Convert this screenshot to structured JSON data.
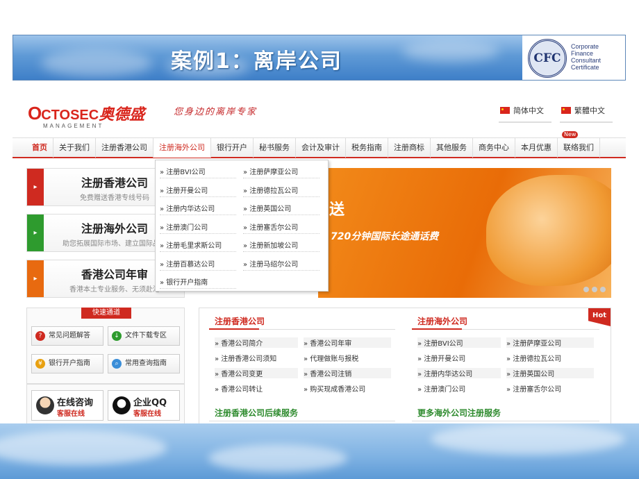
{
  "slide": {
    "title": "案例1：离岸公司",
    "logo_seal": "CFC",
    "logo_text": [
      "Corporate",
      "Finance",
      "Consultant",
      "Certificate"
    ]
  },
  "site": {
    "logo": {
      "o": "O",
      "ctosec": "CTOSEC",
      "cn": "奥德盛",
      "sub": "MANAGEMENT"
    },
    "slogan": "您身边的离岸专家",
    "lang": [
      "简体中文",
      "繁體中文"
    ],
    "nav": [
      "首页",
      "关于我们",
      "注册香港公司",
      "注册海外公司",
      "银行开户",
      "秘书服务",
      "会计及审计",
      "税务指南",
      "注册商标",
      "其他服务",
      "商务中心",
      "本月优惠",
      "联络我们"
    ],
    "nav_badge": "New",
    "promos": [
      {
        "title": "注册香港公司",
        "desc": "免费赠送香港专线号码"
      },
      {
        "title": "注册海外公司",
        "desc": "助您拓展国际市场、建立国际品牌"
      },
      {
        "title": "香港公司年审",
        "desc": "香港本土专业服务、无须赴港"
      }
    ],
    "dropdown": {
      "left": [
        "注册BVI公司",
        "注册开曼公司",
        "注册内华达公司",
        "注册澳门公司",
        "注册毛里求斯公司",
        "注册百慕达公司",
        "银行开户指南"
      ],
      "right": [
        "注册萨摩亚公司",
        "注册德拉瓦公司",
        "注册英国公司",
        "注册塞舌尔公司",
        "注册新加坡公司",
        "注册马绍尔公司"
      ]
    },
    "hero": {
      "big": "送",
      "line2": "720分钟国际长途通话费"
    },
    "quick": {
      "title": "快速通道",
      "buttons": [
        "常见问题解答",
        "文件下载专区",
        "银行开户指南",
        "常用查询指南"
      ]
    },
    "contact": [
      {
        "l1": "在线咨询",
        "l2": "客服在线"
      },
      {
        "l1": "企业QQ",
        "l2": "客服在线"
      }
    ],
    "panel": {
      "hot": "Hot",
      "hk_title": "注册香港公司",
      "hk_links": [
        "香港公司简介",
        "香港公司年审",
        "注册香港公司须知",
        "代理做账与报税",
        "香港公司变更",
        "香港公司注销",
        "香港公司转让",
        "购买现成香港公司"
      ],
      "os_title": "注册海外公司",
      "os_links": [
        "注册BVI公司",
        "注册萨摩亚公司",
        "注册开曼公司",
        "注册德拉瓦公司",
        "注册内华达公司",
        "注册英国公司",
        "注册澳门公司",
        "注册塞舌尔公司"
      ],
      "hk_more": "注册香港公司后续服务",
      "os_more": "更多海外公司注册服务"
    }
  },
  "colors": {
    "brand_red": "#cf2a20",
    "orange": "#e96c07",
    "sky": "#5f9ad6"
  }
}
